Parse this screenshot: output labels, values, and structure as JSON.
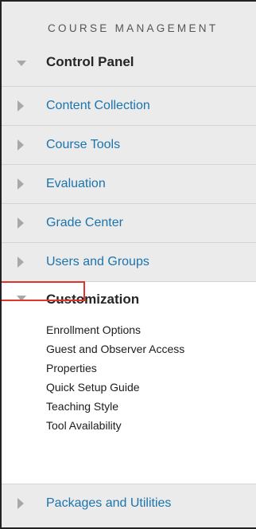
{
  "section_header": "COURSE MANAGEMENT",
  "control_panel": {
    "label": "Control Panel"
  },
  "menu_items": [
    {
      "label": "Content Collection"
    },
    {
      "label": "Course Tools"
    },
    {
      "label": "Evaluation"
    },
    {
      "label": "Grade Center"
    },
    {
      "label": "Users and Groups"
    }
  ],
  "customization": {
    "label": "Customization",
    "items": [
      {
        "label": "Enrollment Options"
      },
      {
        "label": "Guest and Observer Access"
      },
      {
        "label": "Properties",
        "highlighted": true
      },
      {
        "label": "Quick Setup Guide"
      },
      {
        "label": "Teaching Style"
      },
      {
        "label": "Tool Availability"
      }
    ]
  },
  "packages": {
    "label": "Packages and Utilities"
  },
  "colors": {
    "link": "#1b74ad",
    "panel_bg": "#ebebeb",
    "highlight_border": "#e0342b",
    "caret": "#a8a8a8"
  },
  "icons": {
    "expanded": "caret-down-icon",
    "collapsed": "caret-right-icon"
  }
}
